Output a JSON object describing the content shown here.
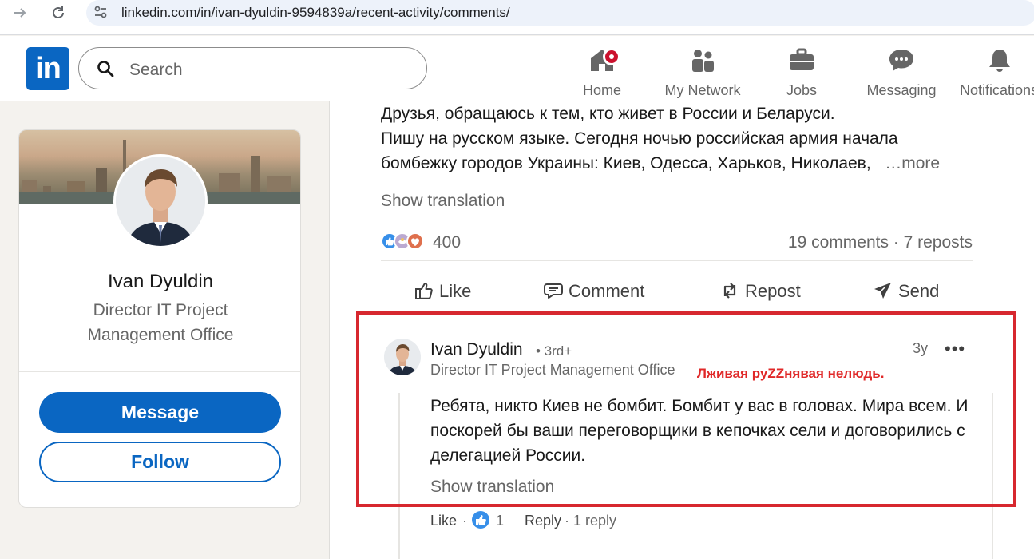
{
  "browser": {
    "url": "linkedin.com/in/ivan-dyuldin-9594839a/recent-activity/comments/"
  },
  "header": {
    "logo_text": "in",
    "search_placeholder": "Search",
    "nav": [
      {
        "label": "Home",
        "icon": "home-icon",
        "notification": true
      },
      {
        "label": "My Network",
        "icon": "people-icon"
      },
      {
        "label": "Jobs",
        "icon": "briefcase-icon"
      },
      {
        "label": "Messaging",
        "icon": "messaging-icon"
      },
      {
        "label": "Notifications",
        "icon": "bell-icon"
      }
    ]
  },
  "profile": {
    "name": "Ivan Dyuldin",
    "title": "Director IT Project Management Office",
    "message_label": "Message",
    "follow_label": "Follow"
  },
  "post": {
    "text_line1": "Друзья, обращаюсь к тем, кто живет в России и Беларуси.",
    "text_line2": "Пишу на русском языке. Сегодня ночью российская армия начала",
    "text_line3": "бомбежку городов Украины: Киев, Одесса, Харьков, Николаев,",
    "more_label": "…more",
    "show_translation": "Show translation",
    "reaction_count": "400",
    "counts": "19 comments · 7 reposts",
    "actions": {
      "like": "Like",
      "comment": "Comment",
      "repost": "Repost",
      "send": "Send"
    }
  },
  "comment": {
    "author": "Ivan Dyuldin",
    "degree": "• 3rd+",
    "headline": "Director IT Project Management Office",
    "annotation": "Лживая руZZнявая нелюдь.",
    "time": "3y",
    "more_menu": "•••",
    "body": "Ребята, никто Киев не бомбит. Бомбит у вас в головах. Мира всем. И поскорей бы ваши переговорщики в кепочках сели и договорились с делегацией России.",
    "show_translation": "Show translation",
    "like_label": "Like",
    "like_count": "1",
    "reply_label": "Reply",
    "reply_count": "· 1 reply"
  },
  "colors": {
    "linkedin_blue": "#0a66c2",
    "highlight_red": "#d7282f",
    "notification_red": "#cb112d"
  }
}
